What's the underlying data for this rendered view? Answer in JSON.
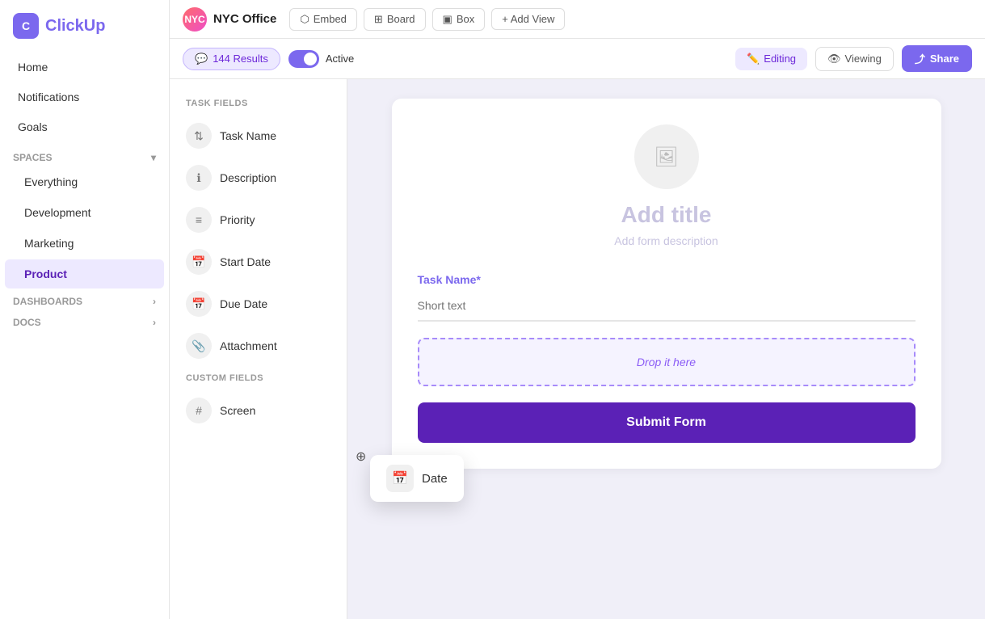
{
  "sidebar": {
    "logo_text": "ClickUp",
    "nav_items": [
      {
        "id": "home",
        "label": "Home",
        "indent": false,
        "active": false
      },
      {
        "id": "notifications",
        "label": "Notifications",
        "indent": false,
        "active": false
      },
      {
        "id": "goals",
        "label": "Goals",
        "indent": false,
        "active": false
      }
    ],
    "spaces_section": "Spaces",
    "spaces_items": [
      {
        "id": "everything",
        "label": "Everything",
        "indent": true,
        "active": false
      },
      {
        "id": "development",
        "label": "Development",
        "indent": true,
        "active": false
      },
      {
        "id": "marketing",
        "label": "Marketing",
        "indent": true,
        "active": false
      },
      {
        "id": "product",
        "label": "Product",
        "indent": true,
        "active": true
      }
    ],
    "dashboards_label": "Dashboards",
    "docs_label": "Docs"
  },
  "topbar": {
    "workspace_icon": "NYC",
    "workspace_name": "NYC Office",
    "embed_label": "Embed",
    "board_label": "Board",
    "box_label": "Box",
    "add_view_label": "+ Add View"
  },
  "toolbar": {
    "results_count": "144 Results",
    "active_label": "Active",
    "editing_label": "Editing",
    "viewing_label": "Viewing",
    "share_label": "Share"
  },
  "fields_panel": {
    "task_fields_title": "TASK FIELDS",
    "task_fields": [
      {
        "id": "task-name",
        "label": "Task Name",
        "icon": "⇅"
      },
      {
        "id": "description",
        "label": "Description",
        "icon": "ℹ"
      },
      {
        "id": "priority",
        "label": "Priority",
        "icon": "≡"
      },
      {
        "id": "start-date",
        "label": "Start Date",
        "icon": "📅"
      },
      {
        "id": "due-date",
        "label": "Due Date",
        "icon": "📅"
      },
      {
        "id": "attachment",
        "label": "Attachment",
        "icon": "📎"
      }
    ],
    "custom_fields_title": "CUSTOM FIELDS",
    "custom_fields": [
      {
        "id": "screen",
        "label": "Screen",
        "icon": "#"
      }
    ]
  },
  "form": {
    "image_placeholder_icon": "🖼",
    "title_placeholder": "Add title",
    "desc_placeholder": "Add form description",
    "task_name_label": "Task Name",
    "task_name_required": "*",
    "task_name_placeholder": "Short text",
    "drop_zone_text": "Drop it here",
    "submit_label": "Submit Form"
  },
  "drag_item": {
    "label": "Date",
    "icon": "📅"
  },
  "colors": {
    "accent": "#7b68ee",
    "dark_accent": "#5b21b6",
    "light_accent": "#ede9ff"
  }
}
